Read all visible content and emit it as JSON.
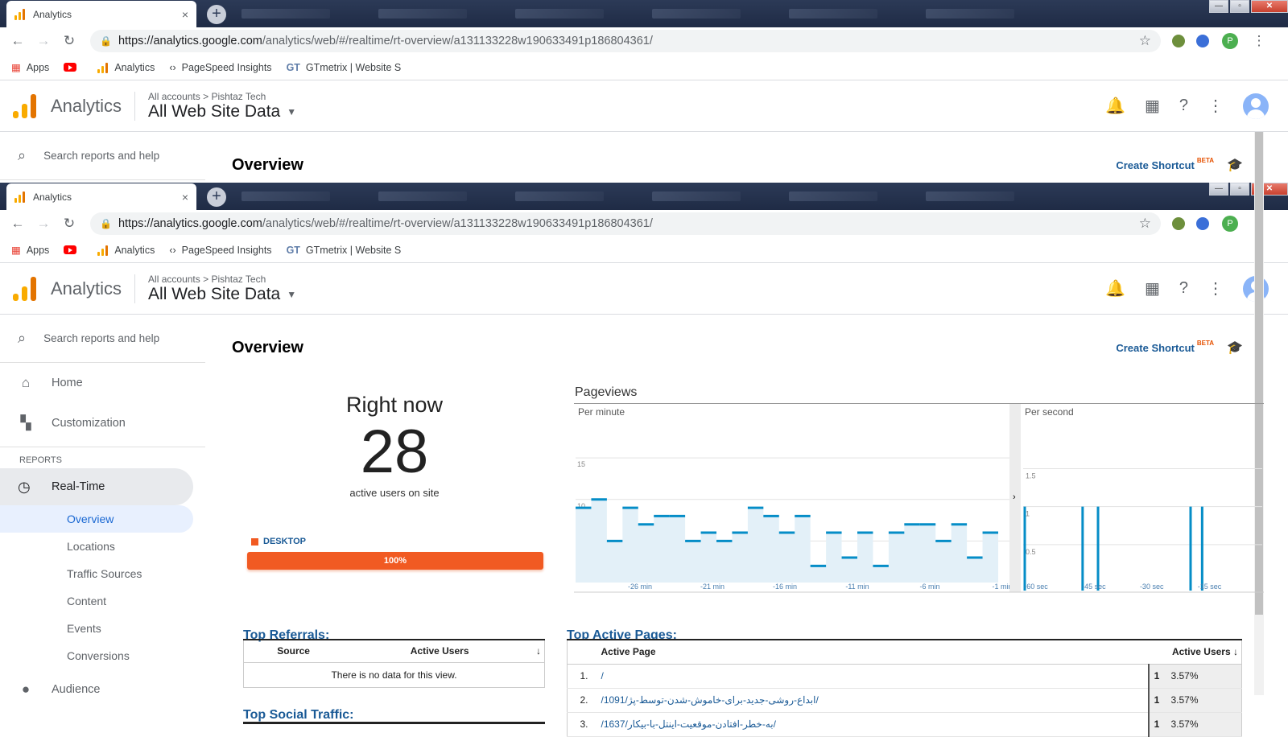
{
  "browser": {
    "tab_title": "Analytics",
    "tab_close": "×",
    "new_tab": "+",
    "url_host": "https://analytics.google.com",
    "url_path": "/analytics/web/#/realtime/rt-overview/a131133228w190633491p186804361/",
    "profile_initial": "P",
    "bookmarks": [
      "Apps",
      "Analytics",
      "PageSpeed Insights",
      "GTmetrix | Website S"
    ],
    "bookmark_gt": "GT"
  },
  "header": {
    "product": "Analytics",
    "crumb_all": "All accounts",
    "crumb_sep": ">",
    "crumb_account": "Pishtaz Tech",
    "property": "All Web Site Data"
  },
  "sidebar": {
    "search_placeholder": "Search reports and help",
    "home": "Home",
    "customization": "Customization",
    "reports_label": "REPORTS",
    "realtime": "Real-Time",
    "sub_items": [
      "Overview",
      "Locations",
      "Traffic Sources",
      "Content",
      "Events",
      "Conversions"
    ],
    "audience": "Audience"
  },
  "main": {
    "title": "Overview",
    "create_shortcut": "Create Shortcut",
    "beta": "BETA"
  },
  "rightnow": {
    "title": "Right now",
    "count": "28",
    "subtitle": "active users on site",
    "device_label": "DESKTOP",
    "device_pct": "100%"
  },
  "chart_data": [
    {
      "type": "area",
      "title": "Pageviews",
      "subtitle": "Per minute",
      "yticks": [
        "15",
        "10",
        "5"
      ],
      "ylim": [
        0,
        20
      ],
      "xtick_labels": [
        "-26 min",
        "-21 min",
        "-16 min",
        "-11 min",
        "-6 min",
        "-1 min"
      ],
      "values": [
        9,
        10,
        5,
        9,
        7,
        8,
        8,
        5,
        6,
        5,
        6,
        9,
        8,
        6,
        8,
        2,
        6,
        3,
        6,
        2,
        6,
        7,
        7,
        5,
        7,
        3,
        6
      ]
    },
    {
      "type": "bar",
      "subtitle": "Per second",
      "yticks": [
        "1.5",
        "1",
        "0.5"
      ],
      "ylim": [
        0,
        2
      ],
      "xtick_labels": [
        "-60 sec",
        "-45 sec",
        "-30 sec",
        "-15 sec"
      ],
      "spikes": [
        {
          "x": -60,
          "y": 1
        },
        {
          "x": -41,
          "y": 1
        },
        {
          "x": -45,
          "y": 1
        },
        {
          "x": -17,
          "y": 1
        },
        {
          "x": -14,
          "y": 1
        }
      ]
    }
  ],
  "referrals": {
    "title": "Top Referrals:",
    "col_source": "Source",
    "col_users": "Active Users",
    "empty": "There is no data for this view."
  },
  "pages": {
    "title": "Top Active Pages:",
    "col_page": "Active Page",
    "col_users": "Active Users",
    "rows": [
      {
        "n": "1.",
        "page": "/",
        "count": "1",
        "pct": "3.57%"
      },
      {
        "n": "2.",
        "page": "/1091/ابداع-روشی-جدید-برای-خاموش-شدن-توسط-پژ/",
        "count": "1",
        "pct": "3.57%"
      },
      {
        "n": "3.",
        "page": "/1637/به-خطر-افتادن-موقعیت-اینتل-با-بیکار/",
        "count": "1",
        "pct": "3.57%"
      }
    ]
  },
  "social": {
    "title": "Top Social Traffic:"
  }
}
